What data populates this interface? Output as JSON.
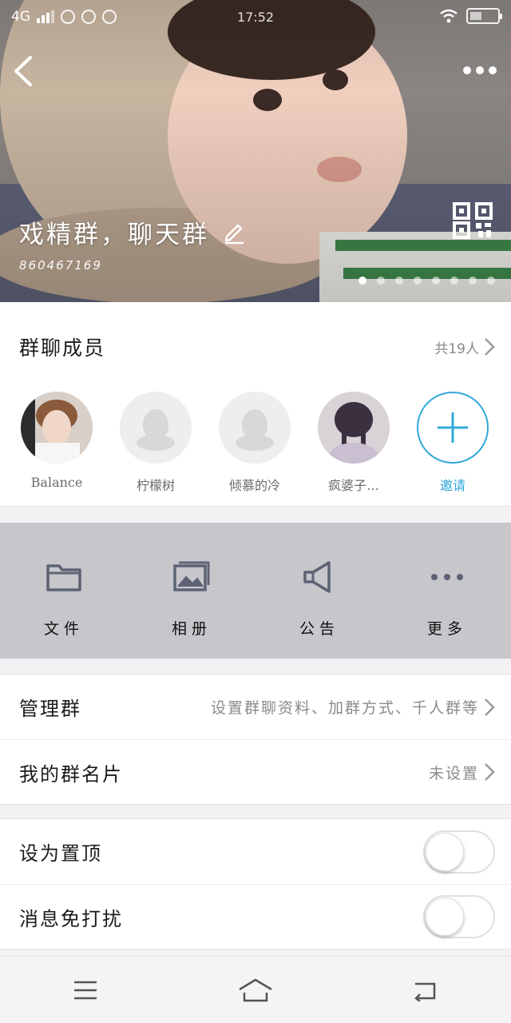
{
  "status_bar": {
    "network": "4G",
    "time": "17:52"
  },
  "header": {
    "group_name": "戏精群，聊天群",
    "group_id": "860467169",
    "carousel_total": 8,
    "carousel_active": 1,
    "icons": [
      "back-icon",
      "more-icon",
      "edit-icon",
      "qr-code-icon"
    ]
  },
  "members": {
    "title": "群聊成员",
    "count_text": "共19人",
    "list": [
      {
        "name": "Balance",
        "avatar": "photo"
      },
      {
        "name": "柠檬树",
        "avatar": "default"
      },
      {
        "name": "倾慕的冷",
        "avatar": "default"
      },
      {
        "name": "疯婆子…",
        "avatar": "photo"
      }
    ],
    "invite_label": "邀请"
  },
  "actions": [
    {
      "label": "文件",
      "icon": "folder-icon"
    },
    {
      "label": "相册",
      "icon": "album-icon"
    },
    {
      "label": "公告",
      "icon": "megaphone-icon"
    },
    {
      "label": "更多",
      "icon": "more-dots-icon"
    }
  ],
  "settings": {
    "manage": {
      "label": "管理群",
      "value": "设置群聊资料、加群方式、千人群等"
    },
    "card": {
      "label": "我的群名片",
      "value": "未设置"
    },
    "pin": {
      "label": "设为置顶",
      "on": false
    },
    "mute": {
      "label": "消息免打扰",
      "on": false
    }
  },
  "colors": {
    "accent": "#33a9d9",
    "actions_bg": "#c6c6cb"
  }
}
